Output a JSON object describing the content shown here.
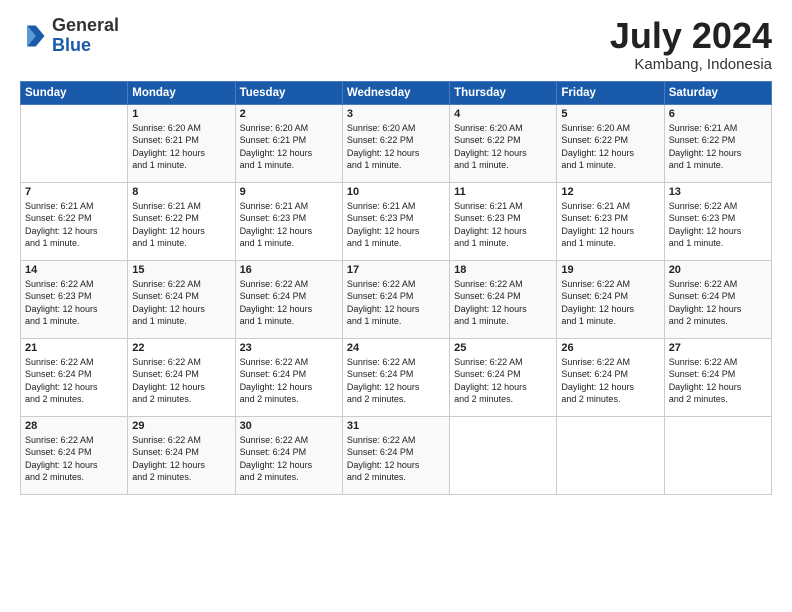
{
  "logo": {
    "general": "General",
    "blue": "Blue"
  },
  "header": {
    "month_year": "July 2024",
    "location": "Kambang, Indonesia"
  },
  "days_of_week": [
    "Sunday",
    "Monday",
    "Tuesday",
    "Wednesday",
    "Thursday",
    "Friday",
    "Saturday"
  ],
  "weeks": [
    [
      {
        "day": "",
        "info": ""
      },
      {
        "day": "1",
        "info": "Sunrise: 6:20 AM\nSunset: 6:21 PM\nDaylight: 12 hours\nand 1 minute."
      },
      {
        "day": "2",
        "info": "Sunrise: 6:20 AM\nSunset: 6:21 PM\nDaylight: 12 hours\nand 1 minute."
      },
      {
        "day": "3",
        "info": "Sunrise: 6:20 AM\nSunset: 6:22 PM\nDaylight: 12 hours\nand 1 minute."
      },
      {
        "day": "4",
        "info": "Sunrise: 6:20 AM\nSunset: 6:22 PM\nDaylight: 12 hours\nand 1 minute."
      },
      {
        "day": "5",
        "info": "Sunrise: 6:20 AM\nSunset: 6:22 PM\nDaylight: 12 hours\nand 1 minute."
      },
      {
        "day": "6",
        "info": "Sunrise: 6:21 AM\nSunset: 6:22 PM\nDaylight: 12 hours\nand 1 minute."
      }
    ],
    [
      {
        "day": "7",
        "info": "Sunrise: 6:21 AM\nSunset: 6:22 PM\nDaylight: 12 hours\nand 1 minute."
      },
      {
        "day": "8",
        "info": "Sunrise: 6:21 AM\nSunset: 6:22 PM\nDaylight: 12 hours\nand 1 minute."
      },
      {
        "day": "9",
        "info": "Sunrise: 6:21 AM\nSunset: 6:23 PM\nDaylight: 12 hours\nand 1 minute."
      },
      {
        "day": "10",
        "info": "Sunrise: 6:21 AM\nSunset: 6:23 PM\nDaylight: 12 hours\nand 1 minute."
      },
      {
        "day": "11",
        "info": "Sunrise: 6:21 AM\nSunset: 6:23 PM\nDaylight: 12 hours\nand 1 minute."
      },
      {
        "day": "12",
        "info": "Sunrise: 6:21 AM\nSunset: 6:23 PM\nDaylight: 12 hours\nand 1 minute."
      },
      {
        "day": "13",
        "info": "Sunrise: 6:22 AM\nSunset: 6:23 PM\nDaylight: 12 hours\nand 1 minute."
      }
    ],
    [
      {
        "day": "14",
        "info": "Sunrise: 6:22 AM\nSunset: 6:23 PM\nDaylight: 12 hours\nand 1 minute."
      },
      {
        "day": "15",
        "info": "Sunrise: 6:22 AM\nSunset: 6:24 PM\nDaylight: 12 hours\nand 1 minute."
      },
      {
        "day": "16",
        "info": "Sunrise: 6:22 AM\nSunset: 6:24 PM\nDaylight: 12 hours\nand 1 minute."
      },
      {
        "day": "17",
        "info": "Sunrise: 6:22 AM\nSunset: 6:24 PM\nDaylight: 12 hours\nand 1 minute."
      },
      {
        "day": "18",
        "info": "Sunrise: 6:22 AM\nSunset: 6:24 PM\nDaylight: 12 hours\nand 1 minute."
      },
      {
        "day": "19",
        "info": "Sunrise: 6:22 AM\nSunset: 6:24 PM\nDaylight: 12 hours\nand 1 minute."
      },
      {
        "day": "20",
        "info": "Sunrise: 6:22 AM\nSunset: 6:24 PM\nDaylight: 12 hours\nand 2 minutes."
      }
    ],
    [
      {
        "day": "21",
        "info": "Sunrise: 6:22 AM\nSunset: 6:24 PM\nDaylight: 12 hours\nand 2 minutes."
      },
      {
        "day": "22",
        "info": "Sunrise: 6:22 AM\nSunset: 6:24 PM\nDaylight: 12 hours\nand 2 minutes."
      },
      {
        "day": "23",
        "info": "Sunrise: 6:22 AM\nSunset: 6:24 PM\nDaylight: 12 hours\nand 2 minutes."
      },
      {
        "day": "24",
        "info": "Sunrise: 6:22 AM\nSunset: 6:24 PM\nDaylight: 12 hours\nand 2 minutes."
      },
      {
        "day": "25",
        "info": "Sunrise: 6:22 AM\nSunset: 6:24 PM\nDaylight: 12 hours\nand 2 minutes."
      },
      {
        "day": "26",
        "info": "Sunrise: 6:22 AM\nSunset: 6:24 PM\nDaylight: 12 hours\nand 2 minutes."
      },
      {
        "day": "27",
        "info": "Sunrise: 6:22 AM\nSunset: 6:24 PM\nDaylight: 12 hours\nand 2 minutes."
      }
    ],
    [
      {
        "day": "28",
        "info": "Sunrise: 6:22 AM\nSunset: 6:24 PM\nDaylight: 12 hours\nand 2 minutes."
      },
      {
        "day": "29",
        "info": "Sunrise: 6:22 AM\nSunset: 6:24 PM\nDaylight: 12 hours\nand 2 minutes."
      },
      {
        "day": "30",
        "info": "Sunrise: 6:22 AM\nSunset: 6:24 PM\nDaylight: 12 hours\nand 2 minutes."
      },
      {
        "day": "31",
        "info": "Sunrise: 6:22 AM\nSunset: 6:24 PM\nDaylight: 12 hours\nand 2 minutes."
      },
      {
        "day": "",
        "info": ""
      },
      {
        "day": "",
        "info": ""
      },
      {
        "day": "",
        "info": ""
      }
    ]
  ]
}
